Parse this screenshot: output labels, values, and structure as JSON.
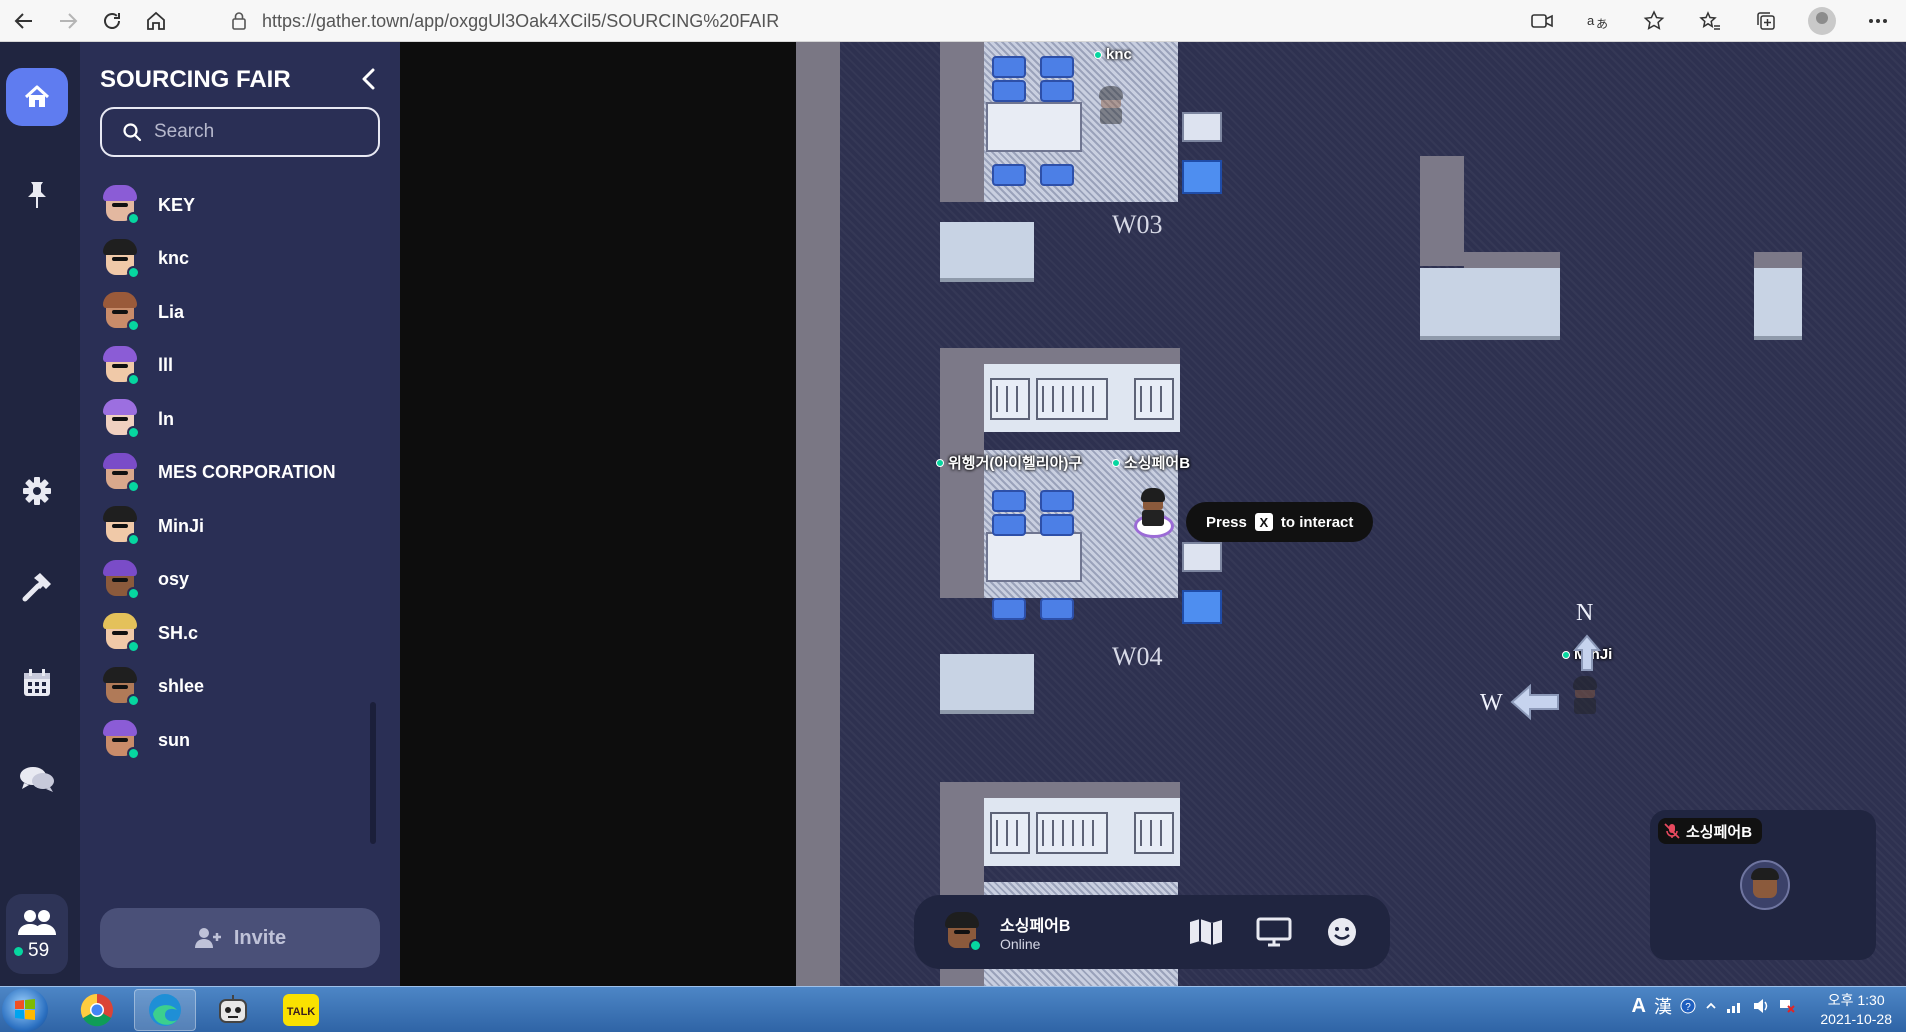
{
  "browser": {
    "url": "https://gather.town/app/oxggUl3Oak4XCil5/SOURCING%20FAIR"
  },
  "rail": {
    "member_count": "59",
    "items": [
      "home-icon",
      "pin-icon",
      "gear-icon",
      "hammer-icon",
      "calendar-icon",
      "chat-icon",
      "people-icon"
    ]
  },
  "sidebar": {
    "title": "SOURCING FAIR",
    "search_placeholder": "Search",
    "invite_label": "Invite",
    "members": [
      {
        "name": "KEY",
        "hair": "#8b5cd6",
        "skin": "#e3b8a0"
      },
      {
        "name": "knc",
        "hair": "#1f1f1f",
        "skin": "#f0c9a8"
      },
      {
        "name": "Lia",
        "hair": "#9a5a3a",
        "skin": "#c98c6a"
      },
      {
        "name": "lll",
        "hair": "#8b5cd6",
        "skin": "#f0c9a8"
      },
      {
        "name": "ln",
        "hair": "#9c6fe0",
        "skin": "#f0d0c0"
      },
      {
        "name": "MES CORPORATION",
        "hair": "#7a4cc8",
        "skin": "#d9a88c"
      },
      {
        "name": "MinJi",
        "hair": "#1f1f1f",
        "skin": "#f0c9a8"
      },
      {
        "name": "osy",
        "hair": "#7a4cc8",
        "skin": "#8b5a3c"
      },
      {
        "name": "SH.c",
        "hair": "#e4c15a",
        "skin": "#f0c9a8"
      },
      {
        "name": "shlee",
        "hair": "#1f1f1f",
        "skin": "#b07a58"
      },
      {
        "name": "sun",
        "hair": "#8b5cd6",
        "skin": "#c98c6a"
      }
    ]
  },
  "map": {
    "booths": [
      "W03",
      "W04"
    ],
    "players": {
      "knc": "knc",
      "wi": "위헹거(아이헬리아)구",
      "me": "소싱페어B",
      "minji": "MinJi"
    },
    "compass": {
      "n": "N",
      "w": "W"
    },
    "interact": {
      "press": "Press",
      "key": "X",
      "action": "to interact"
    }
  },
  "status": {
    "name": "소싱페어B",
    "state": "Online"
  },
  "video": {
    "name": "소싱페어B"
  },
  "taskbar": {
    "time": "오후 1:30",
    "date": "2021-10-28",
    "ime_a": "A",
    "ime_han": "漢"
  },
  "colors": {
    "sidebar_bg": "#2a2f55",
    "rail_bg": "#202540",
    "accent": "#5f7cf0",
    "online": "#06d6a0"
  }
}
